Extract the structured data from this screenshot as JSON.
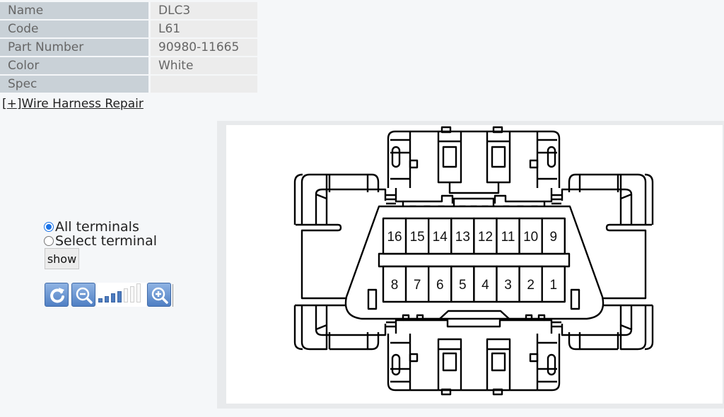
{
  "info": {
    "rows": [
      {
        "label": "Name",
        "value": "DLC3"
      },
      {
        "label": "Code",
        "value": "L61"
      },
      {
        "label": "Part Number",
        "value": "90980-11665"
      },
      {
        "label": "Color",
        "value": "White"
      },
      {
        "label": "Spec",
        "value": ""
      }
    ]
  },
  "harness_link": {
    "open_bracket": "[",
    "toggle": "+",
    "close_bracket": "]",
    "label": "Wire Harness Repair"
  },
  "terminal_options": {
    "selected": "all",
    "options": [
      {
        "id": "all",
        "label": "All terminals"
      },
      {
        "id": "select",
        "label": "Select terminal"
      }
    ],
    "show_label": "show"
  },
  "zoom_toolbar": {
    "reset_icon": "rotate-reset-icon",
    "zoom_out_icon": "zoom-out-icon",
    "zoom_in_icon": "zoom-in-icon",
    "zoom_level": 4,
    "zoom_levels_total": 7
  },
  "connector": {
    "top_row": [
      "16",
      "15",
      "14",
      "13",
      "12",
      "11",
      "10",
      "9"
    ],
    "bottom_row": [
      "8",
      "7",
      "6",
      "5",
      "4",
      "3",
      "2",
      "1"
    ]
  }
}
